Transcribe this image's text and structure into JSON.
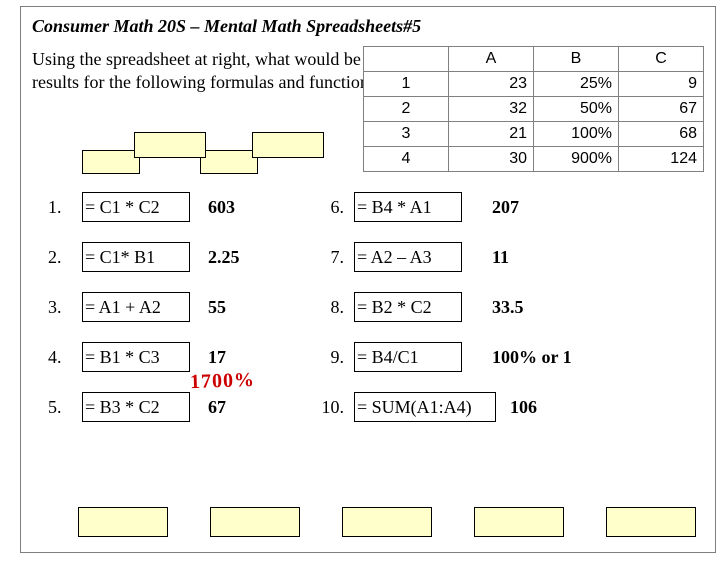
{
  "title": "Consumer Math 20S – Mental Math   Spreadsheets#5",
  "intro": "Using the spreadsheet at right, what would be the results for the following formulas and functions?",
  "sheet": {
    "cols": [
      "A",
      "B",
      "C"
    ],
    "rows": [
      {
        "n": "1",
        "a": "23",
        "b": "25%",
        "c": "9"
      },
      {
        "n": "2",
        "a": "32",
        "b": "50%",
        "c": "67"
      },
      {
        "n": "3",
        "a": "21",
        "b": "100%",
        "c": "68"
      },
      {
        "n": "4",
        "a": "30",
        "b": "900%",
        "c": "124"
      }
    ]
  },
  "left": [
    {
      "num": "1.",
      "formula": "= C1 * C2",
      "answer": "603"
    },
    {
      "num": "2.",
      "formula": "= C1* B1",
      "answer": "2.25"
    },
    {
      "num": "3.",
      "formula": "= A1 + A2",
      "answer": "55"
    },
    {
      "num": "4.",
      "formula": "= B1 * C3",
      "answer": "17"
    },
    {
      "num": "5.",
      "formula": "= B3 * C2",
      "answer": "67"
    }
  ],
  "right": [
    {
      "num": "6.",
      "formula": "= B4 * A1",
      "answer": "207"
    },
    {
      "num": "7.",
      "formula": "= A2 – A3",
      "answer": "11"
    },
    {
      "num": "8.",
      "formula": "= B2 * C2",
      "answer": "33.5"
    },
    {
      "num": "9.",
      "formula": "= B4/C1",
      "answer": "100% or 1"
    },
    {
      "num": "10.",
      "formula": "= SUM(A1:A4)",
      "answer": "106"
    }
  ],
  "handwritten": "1700%"
}
